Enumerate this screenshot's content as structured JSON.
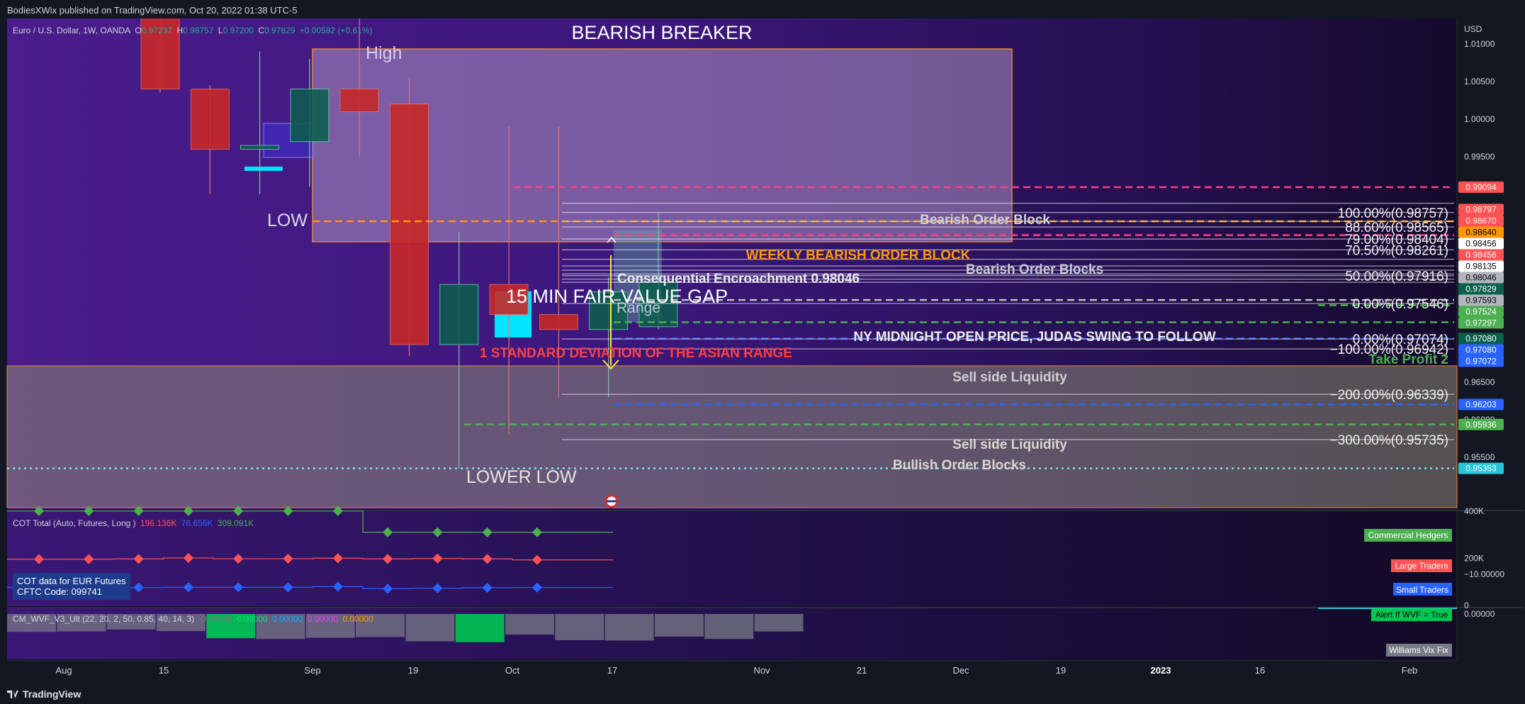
{
  "header": {
    "published_text": "BodiesXWix published on TradingView.com, Oct 20, 2022 01:38 UTC-5"
  },
  "footer": {
    "brand": "TradingView"
  },
  "main_legend": {
    "symbol": "Euro / U.S. Dollar, 1W, OANDA",
    "o_label": "O",
    "o_value": "0.97237",
    "h_label": "H",
    "h_value": "0.98757",
    "l_label": "L",
    "l_value": "0.97200",
    "c_label": "C",
    "c_value": "0.97829",
    "change": "+0.00592 (+0.61%)"
  },
  "cot_legend": {
    "title": "COT Total (Auto, Futures, Long )",
    "v1": "196.136K",
    "v2": "76.656K",
    "v3": "309.091K"
  },
  "cot_note": {
    "line1": "COT data for EUR Futures",
    "line2": "CFTC Code: 099741"
  },
  "wvf_legend": {
    "title": "CM_WVF_V3_Ult (22, 20, 2, 50, 0.85, 40, 14, 3)",
    "v1": "-0.44156",
    "v2": "0.00000",
    "v3": "0.00000",
    "v4": "0.00000",
    "v5": "0.00000"
  },
  "currency": "USD",
  "colors": {
    "bg": "#131722",
    "purple": "#3a1573",
    "up": "#0b5f4c",
    "down": "#c62828",
    "cyan": "#00e5ff",
    "green": "#4caf50",
    "red": "#ff5252",
    "blue": "#2962ff",
    "orange": "#ff9800"
  },
  "chart_data": [
    {
      "type": "candlestick",
      "title": "Euro / U.S. Dollar, 1W, OANDA",
      "ylim": [
        0.951,
        1.0175
      ],
      "y_ticks": [
        "1.01000",
        "1.00500",
        "1.00000",
        "0.99500",
        "0.96500",
        "0.96000",
        "0.95500"
      ],
      "x_ticks": [
        "Aug",
        "15",
        "Sep",
        "19",
        "Oct",
        "17",
        "Nov",
        "21",
        "Dec",
        "19",
        "2023",
        "16",
        "Feb"
      ],
      "candles": [
        {
          "week": "Aug 08",
          "open": 1.017,
          "high": 1.019,
          "low": 1.0035,
          "close": 1.004
        },
        {
          "week": "Aug 15",
          "open": 1.004,
          "high": 1.0045,
          "low": 0.99,
          "close": 0.996
        },
        {
          "week": "Aug 22",
          "open": 0.996,
          "high": 1.009,
          "low": 0.99,
          "close": 0.9965
        },
        {
          "week": "Aug 29",
          "open": 0.997,
          "high": 1.008,
          "low": 0.991,
          "close": 1.004
        },
        {
          "week": "Sep 05",
          "open": 1.004,
          "high": 1.02,
          "low": 0.995,
          "close": 1.001
        },
        {
          "week": "Sep 12",
          "open": 1.002,
          "high": 1.0055,
          "low": 0.9685,
          "close": 0.97
        },
        {
          "week": "Sep 19",
          "open": 0.97,
          "high": 0.985,
          "low": 0.9535,
          "close": 0.978
        },
        {
          "week": "Sep 26",
          "open": 0.978,
          "high": 0.999,
          "low": 0.958,
          "close": 0.974
        },
        {
          "week": "Oct 03",
          "open": 0.974,
          "high": 0.999,
          "low": 0.963,
          "close": 0.972
        },
        {
          "week": "Oct 10",
          "open": 0.972,
          "high": 0.979,
          "low": 0.963,
          "close": 0.977
        },
        {
          "week": "Oct 17",
          "open": 0.97237,
          "high": 0.98757,
          "low": 0.972,
          "close": 0.97829
        }
      ],
      "price_tags": [
        {
          "value": "0.99094",
          "color": "#ff5252"
        },
        {
          "value": "0.98797",
          "color": "#ff5252"
        },
        {
          "value": "0.98670",
          "color": "#ff5252"
        },
        {
          "value": "0.98640",
          "color": "#ff9800"
        },
        {
          "value": "0.98456",
          "color": "#ffffff"
        },
        {
          "value": "0.98456",
          "color": "#ff5252"
        },
        {
          "value": "0.98135",
          "color": "#ffffff"
        },
        {
          "value": "0.98046",
          "color": "#b2b5be"
        },
        {
          "value": "0.97829",
          "color": "#0b5f4c"
        },
        {
          "value": "0.97593",
          "color": "#b2b5be"
        },
        {
          "value": "0.97524",
          "color": "#4caf50"
        },
        {
          "value": "0.97297",
          "color": "#4caf50"
        },
        {
          "value": "0.97080",
          "color": "#0b5f4c"
        },
        {
          "value": "0.97080",
          "color": "#2962ff"
        },
        {
          "value": "0.97072",
          "color": "#2962ff"
        },
        {
          "value": "0.96203",
          "color": "#2962ff"
        },
        {
          "value": "0.95936",
          "color": "#4caf50"
        },
        {
          "value": "0.95353",
          "color": "#26c6da"
        }
      ],
      "fib_labels": [
        "100.00%(0.98757)",
        "88.60%(0.98565)",
        "79.00%(0.98404)",
        "70.50%(0.98261)",
        "50.00%(0.97916)",
        "0.00%(0.97546)",
        "0.00%(0.97074)",
        "−100.00%(0.96942)",
        "−200.00%(0.96339)",
        "−300.00%(0.95735)"
      ],
      "annotations": [
        "BEARISH BREAKER",
        "High",
        "LOW",
        "LOWER LOW",
        "Bearish Order Block",
        "WEEKLY BEARISH ORDER BLOCK",
        "Bearish Order Blocks",
        "Consequential Encroachment 0.98046",
        "15 MIN FAIR VALUE GAP",
        "Range",
        "1 STANDARD DEVIATION OF THE ASIAN RANGE",
        "NY MIDNIGHT OPEN PRICE, JUDAS SWING TO FOLLOW",
        "Take Profit 2",
        "Sell side Liquidity",
        "Sell side Liquidity",
        "Bullish Order Blocks"
      ]
    },
    {
      "type": "line",
      "title": "COT Total (Auto, Futures, Long )",
      "ylim": [
        0,
        450000
      ],
      "y_ticks": [
        "400K",
        "200K",
        "0"
      ],
      "series": [
        {
          "name": "Commercial Hedgers",
          "color": "#4caf50",
          "values": [
            400000,
            400000,
            400000,
            400000,
            400000,
            400000,
            400000,
            310000,
            310000,
            310000,
            310000
          ]
        },
        {
          "name": "Large Traders",
          "color": "#ff5252",
          "values": [
            196000,
            196000,
            197000,
            201000,
            198000,
            198000,
            200000,
            197000,
            199000,
            197000,
            193000
          ]
        },
        {
          "name": "Small Traders",
          "color": "#2962ff",
          "values": [
            77000,
            76000,
            76000,
            77000,
            77000,
            77000,
            80000,
            71000,
            73000,
            75000,
            76000
          ]
        }
      ]
    },
    {
      "type": "bar",
      "title": "CM_WVF_V3_Ult (22, 20, 2, 50, 0.85, 40, 14, 3)",
      "ylim": [
        -11.5,
        0.5
      ],
      "y_ticks": [
        "0.00000",
        "−10.00000"
      ],
      "values": [
        -4.5,
        -4.4,
        -3.9,
        -4.3,
        -6.1,
        -6.3,
        -6.0,
        -5.8,
        -6.9,
        -7.1,
        -5.2,
        -6.6,
        -6.7,
        -5.7,
        -6.3,
        -4.4
      ],
      "highlight": [
        false,
        false,
        false,
        false,
        true,
        false,
        false,
        false,
        false,
        true,
        false,
        false,
        false,
        false,
        false,
        false
      ],
      "legend": [
        "Alert If WVF = True",
        "Williams Vix Fix"
      ]
    }
  ]
}
